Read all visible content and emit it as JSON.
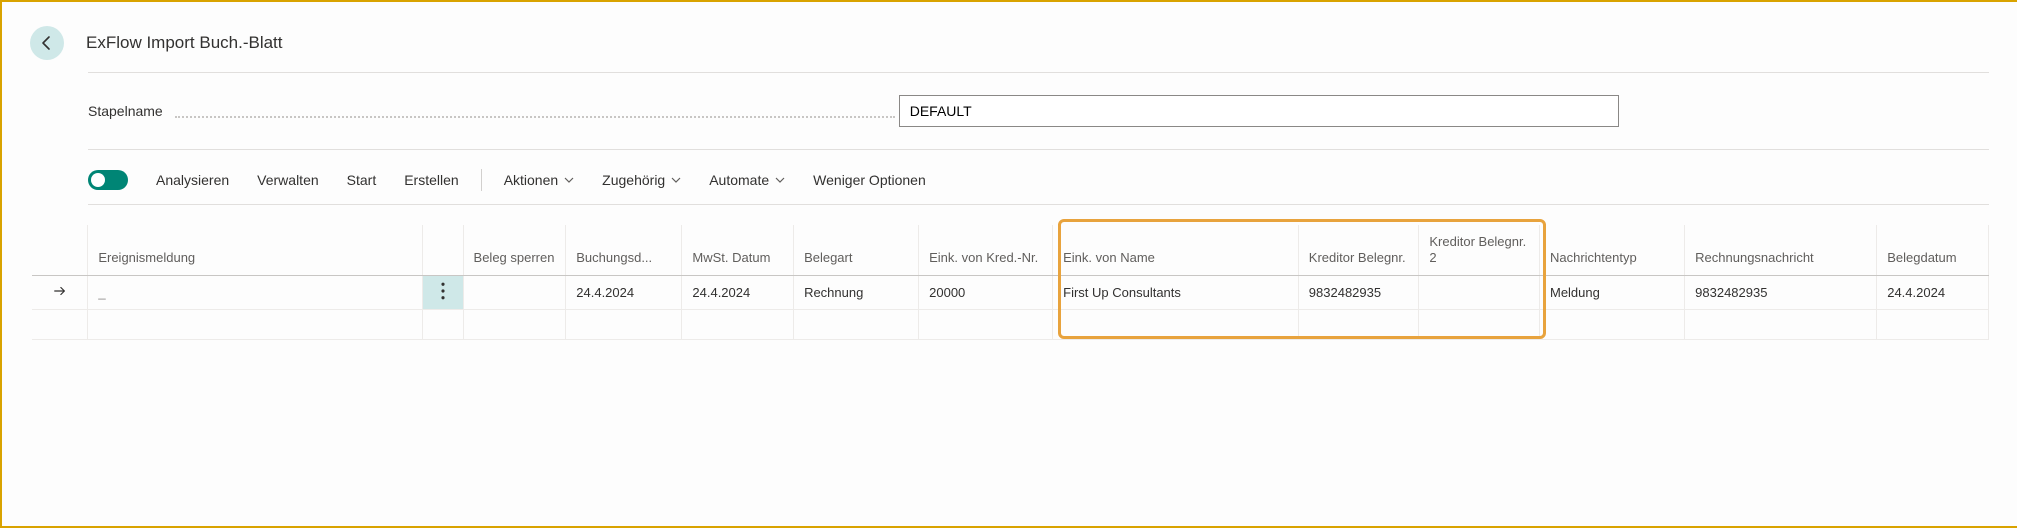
{
  "page_title": "ExFlow Import Buch.-Blatt",
  "batch": {
    "label": "Stapelname",
    "value": "DEFAULT"
  },
  "toolbar": {
    "analyze": "Analysieren",
    "manage": "Verwalten",
    "start": "Start",
    "create": "Erstellen",
    "actions": "Aktionen",
    "related": "Zugehörig",
    "automate": "Automate",
    "fewer": "Weniger Optionen"
  },
  "columns": {
    "ereignis": "Ereignismeldung",
    "sperren": "Beleg sperren",
    "buchungsd": "Buchungsd...",
    "mwst": "MwSt. Datum",
    "belegart": "Belegart",
    "eink_nr": "Eink. von Kred.-Nr.",
    "eink_name": "Eink. von Name",
    "kred_beleg1": "Kreditor Belegnr.",
    "kred_beleg2": "Kreditor Belegnr. 2",
    "nachrichtentyp": "Nachrichtentyp",
    "rechnungsnachricht": "Rechnungsnachricht",
    "belegdatum": "Belegdatum"
  },
  "row": {
    "ereignis": "_",
    "buchungsd": "24.4.2024",
    "mwst": "24.4.2024",
    "belegart": "Rechnung",
    "eink_nr": "20000",
    "eink_name": "First Up Consultants",
    "kred_beleg1": "9832482935",
    "kred_beleg2": "",
    "nachrichtentyp": "Meldung",
    "rechnungsnachricht": "9832482935",
    "belegdatum": "24.4.2024"
  }
}
